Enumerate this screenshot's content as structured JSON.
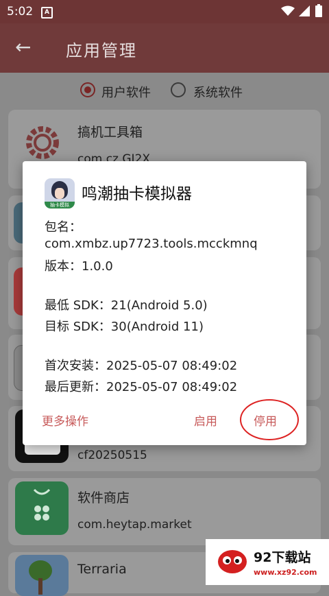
{
  "status_bar": {
    "time": "5:02",
    "notif_icon": "A"
  },
  "app_bar": {
    "title": "应用管理"
  },
  "filters": {
    "user": "用户软件",
    "system": "系统软件",
    "selected": "user"
  },
  "apps": [
    {
      "name": "搞机工具箱",
      "pkg": "com.cz.GJ2X"
    },
    {
      "name": "",
      "pkg": ""
    },
    {
      "name": "",
      "pkg": ""
    },
    {
      "name": "",
      "pkg": ""
    },
    {
      "name": "",
      "pkg": "cf20250515"
    },
    {
      "name": "软件商店",
      "pkg": "com.heytap.market"
    },
    {
      "name": "Terraria",
      "pkg": ""
    }
  ],
  "dialog": {
    "title": "鸣潮抽卡模拟器",
    "pkg_label": "包名：",
    "pkg": "com.xmbz.up7723.tools.mcckmnq",
    "version": "版本：1.0.0",
    "min_sdk": "最低 SDK：21(Android 5.0)",
    "target_sdk": "目标 SDK：30(Android 11)",
    "first_install": "首次安装：2025-05-07 08:49:02",
    "last_update": "最后更新：2025-05-07 08:49:02",
    "btn_more": "更多操作",
    "btn_enable": "启用",
    "btn_disable": "停用",
    "icon_text": "抽卡模拟"
  },
  "watermark": {
    "text": "92下载站",
    "url": "www.xz92.com"
  }
}
